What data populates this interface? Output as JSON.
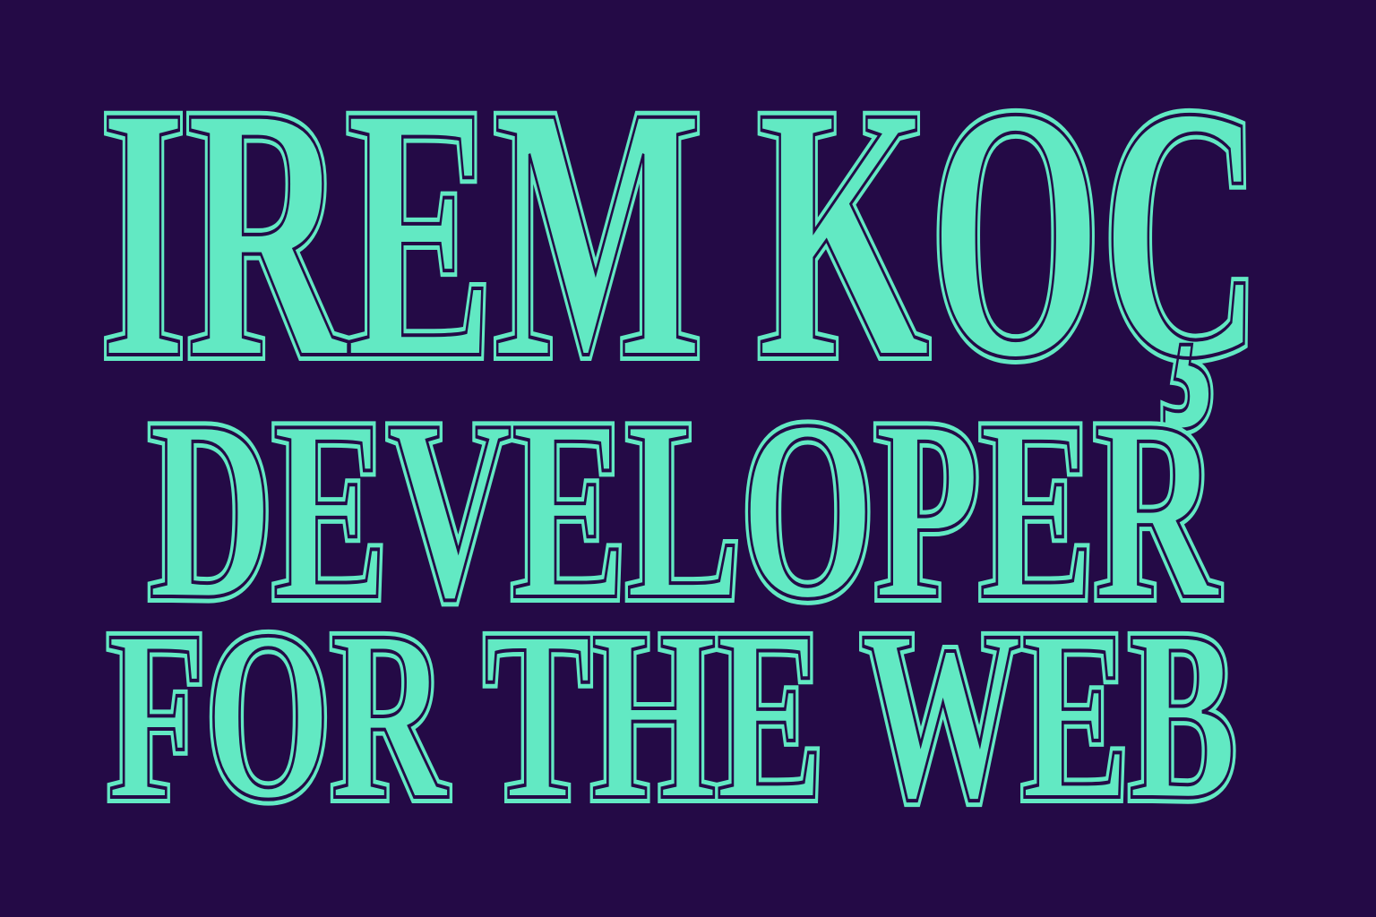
{
  "poster": {
    "line1": "IREM KOÇ",
    "line2": "DEVELOPER",
    "line3": "FOR THE WEB"
  },
  "colors": {
    "background": "#240a46",
    "text": "#62e9c3"
  }
}
